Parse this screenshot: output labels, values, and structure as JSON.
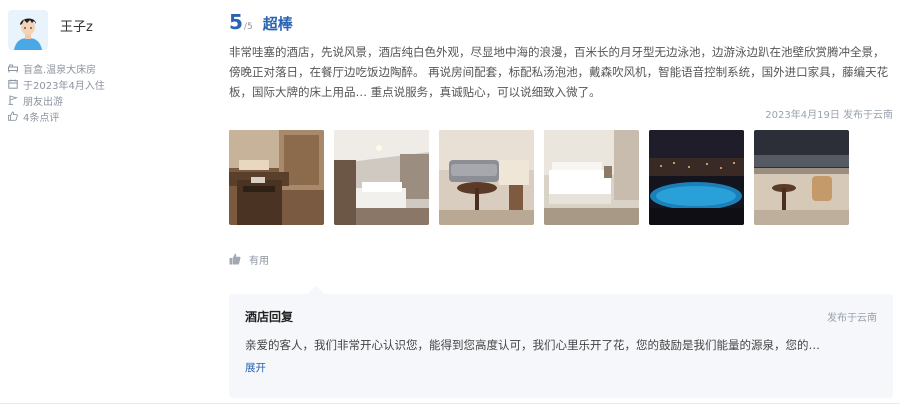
{
  "user": {
    "name": "王子z",
    "room_type": "盲盒.温泉大床房",
    "stay_date": "于2023年4月入住",
    "travel_type": "朋友出游",
    "review_count": "4条点评"
  },
  "rating": {
    "score": "5",
    "max": "/5",
    "label": "超棒"
  },
  "review": {
    "text": "非常哇塞的酒店，先说风景，酒店纯白色外观，尽显地中海的浪漫，百米长的月牙型无边泳池，边游泳边趴在池壁欣赏腾冲全景，傍晚正对落日，在餐厅边吃饭边陶醉。 再说房间配套，标配私汤泡池，戴森吹风机，智能语音控制系统，国外进口家具，藤编天花板，国际大牌的床上用品… 重点说服务，真诚贴心，可以说细致入微了。",
    "meta": "2023年4月19日 发布于云南"
  },
  "photos": [
    {
      "icon": "photo-room-desk"
    },
    {
      "icon": "photo-room-beds"
    },
    {
      "icon": "photo-sofa"
    },
    {
      "icon": "photo-bed"
    },
    {
      "icon": "photo-night-pool"
    },
    {
      "icon": "photo-terrace"
    }
  ],
  "useful": {
    "label": "有用",
    "icon": "thumbs-up-icon"
  },
  "reply": {
    "title": "酒店回复",
    "from": "发布于云南",
    "text": "亲爱的客人，我们非常开心认识您，能得到您高度认可，我们心里乐开了花，您的鼓励是我们能量的源泉，您的…",
    "expand": "展开"
  },
  "colors": {
    "accent": "#2a63b4",
    "muted": "#8d95a0",
    "reply_bg": "#f5f7fa"
  }
}
